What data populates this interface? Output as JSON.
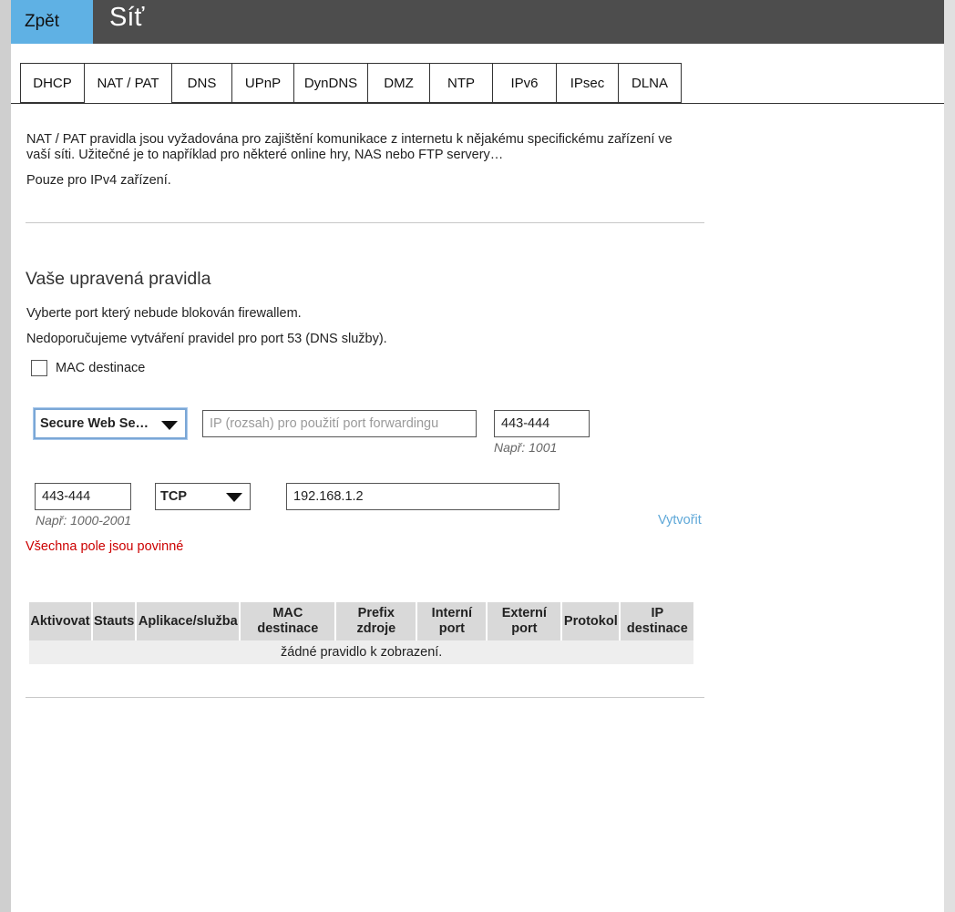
{
  "header": {
    "back_label": "Zpět",
    "title": "Síť"
  },
  "tabs": [
    {
      "label": "DHCP",
      "active": false
    },
    {
      "label": "NAT / PAT",
      "active": true
    },
    {
      "label": "DNS",
      "active": false
    },
    {
      "label": "UPnP",
      "active": false
    },
    {
      "label": "DynDNS",
      "active": false
    },
    {
      "label": "DMZ",
      "active": false
    },
    {
      "label": "NTP",
      "active": false
    },
    {
      "label": "IPv6",
      "active": false
    },
    {
      "label": "IPsec",
      "active": false
    },
    {
      "label": "DLNA",
      "active": false
    }
  ],
  "intro": {
    "line1": "NAT / PAT pravidla jsou vyžadována pro zajištění komunikace z internetu k nějakému specifickému zařízení ve",
    "line2": "vaší síti. Užitečné je to například pro některé online hry, NAS nebo FTP servery…",
    "line3": "Pouze pro IPv4 zařízení."
  },
  "rules_section": {
    "title": "Vaše upravená pravidla",
    "desc1": "Vyberte port který nebude blokován firewallem.",
    "desc2": "Nedoporučujeme vytváření pravidel pro port 53 (DNS služby).",
    "mac_checkbox_label": "MAC destinace",
    "mac_checked": false
  },
  "form": {
    "app_select_value": "Secure Web Se…",
    "ip_range_placeholder": "IP (rozsah) pro použití port forwardingu",
    "ip_range_value": "",
    "external_port_value": "443-444",
    "external_port_hint": "Např: 1001",
    "internal_port_value": "443-444",
    "internal_port_hint": "Např: 1000-2001",
    "protocol_value": "TCP",
    "ip_dest_value": "192.168.1.2",
    "create_label": "Vytvořit",
    "required_note": "Všechna pole jsou povinné"
  },
  "table": {
    "columns": [
      "Aktivovat",
      "Stauts",
      "Aplikace/služba",
      "MAC destinace",
      "Prefix zdroje",
      "Interní port",
      "Externí port",
      "Protokol",
      "IP destinace"
    ],
    "empty_message": "žádné pravidlo k zobrazení."
  },
  "colors": {
    "accent": "#5fb1e4",
    "header_bg": "#4d4d4d",
    "error": "#cc0000",
    "link": "#5fa8d8"
  }
}
